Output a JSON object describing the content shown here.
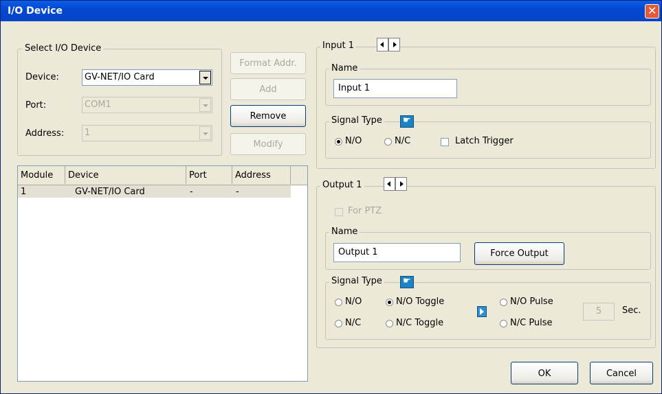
{
  "window": {
    "title": "I/O Device"
  },
  "select_io_device": {
    "legend": "Select I/O Device",
    "device_label": "Device:",
    "device_value": "GV-NET/IO Card",
    "port_label": "Port:",
    "port_value": "COM1",
    "address_label": "Address:",
    "address_value": "1"
  },
  "actions": {
    "format_addr": "Format Addr.",
    "add": "Add",
    "remove": "Remove",
    "modify": "Modify"
  },
  "device_list": {
    "columns": [
      "Module",
      "Device",
      "Port",
      "Address"
    ],
    "rows": [
      {
        "module": "1",
        "device": "GV-NET/IO Card",
        "port": "-",
        "address": "-"
      }
    ]
  },
  "input": {
    "legend": "Input 1",
    "name_legend": "Name",
    "name_value": "Input 1",
    "signal_legend": "Signal Type",
    "no_label": "N/O",
    "nc_label": "N/C",
    "latch_label": "Latch Trigger",
    "selected": "N/O"
  },
  "output": {
    "legend": "Output 1",
    "for_ptz_label": "For PTZ",
    "name_legend": "Name",
    "name_value": "Output 1",
    "force_output": "Force Output",
    "signal_legend": "Signal Type",
    "no_label": "N/O",
    "nc_label": "N/C",
    "no_toggle_label": "N/O Toggle",
    "nc_toggle_label": "N/C Toggle",
    "no_pulse_label": "N/O Pulse",
    "nc_pulse_label": "N/C Pulse",
    "pulse_value": "5",
    "sec_label": "Sec.",
    "selected": "N/O Toggle"
  },
  "footer": {
    "ok": "OK",
    "cancel": "Cancel"
  }
}
